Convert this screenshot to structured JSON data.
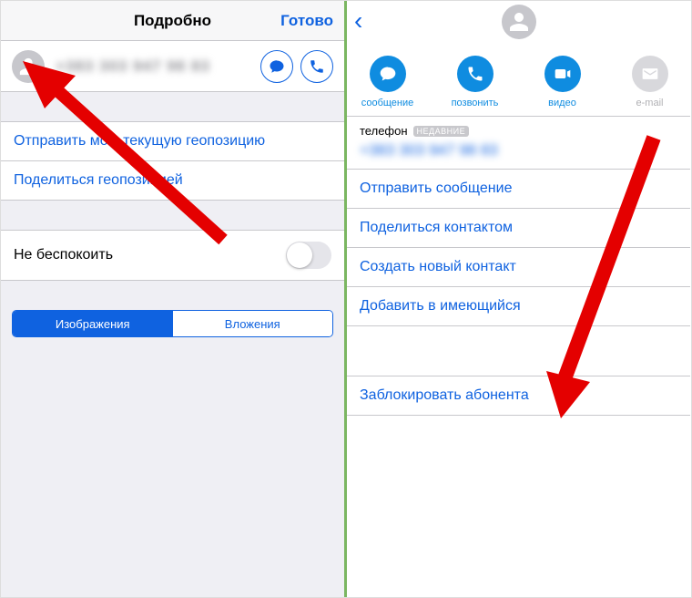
{
  "left": {
    "title": "Подробно",
    "done": "Готово",
    "phone_blurred": "+383 303 947 98 83",
    "send_location": "Отправить мою текущую геопозицию",
    "share_location": "Поделиться геопозицией",
    "dnd": "Не беспокоить",
    "segment": {
      "images": "Изображения",
      "attachments": "Вложения"
    }
  },
  "right": {
    "actions": {
      "message": "сообщение",
      "call": "позвонить",
      "video": "видео",
      "email": "e-mail"
    },
    "phone_label": "телефон",
    "badge": "НЕДАВНИЕ",
    "phone_blurred": "+383 303 947 98 83",
    "send_message": "Отправить сообщение",
    "share_contact": "Поделиться контактом",
    "new_contact": "Создать новый контакт",
    "add_existing": "Добавить в имеющийся",
    "block": "Заблокировать абонента"
  }
}
